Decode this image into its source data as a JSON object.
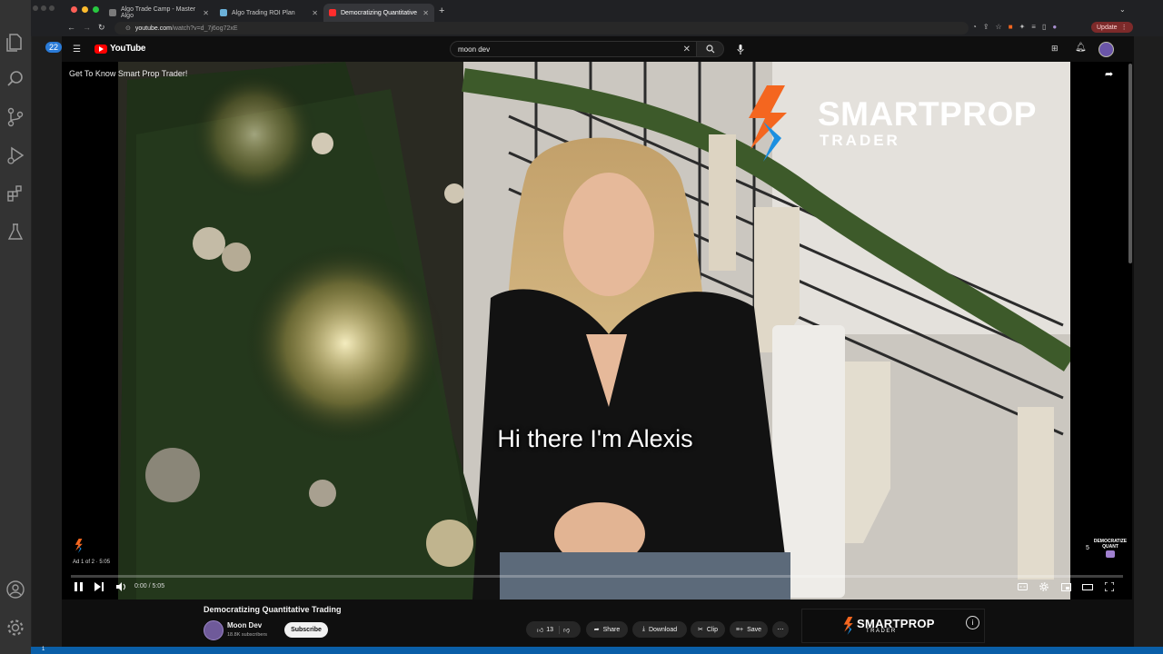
{
  "vscode": {
    "activity_badge": "22",
    "status_left": "1"
  },
  "browser": {
    "tabs": [
      {
        "label": "Algo Trade Camp - Master Algo",
        "color": "#7a7a7a"
      },
      {
        "label": "Algo Trading ROI Plan",
        "color": "#6ab0d8"
      },
      {
        "label": "Democratizing Quantitative",
        "color": "#ff2d2d"
      }
    ],
    "url_host": "youtube.com",
    "url_path": "/watch?v=d_7j6og72xE",
    "update_label": "Update"
  },
  "youtube": {
    "logo": "YouTube",
    "search_value": "moon dev",
    "video_overlay_title": "Get To Know Smart Prop Trader!",
    "subtitle": "Hi there I'm Alexis",
    "brand_main": "SMARTPROP",
    "brand_sub": "TRADER",
    "ad_info": "Ad 1 of 2 · 5:05",
    "time_display": "0:00 / 5:05",
    "skip_count": "5",
    "watermark": "DEMOCRATIZE QUANT",
    "video_title": "Democratizing Quantitative Trading",
    "channel_name": "Moon Dev",
    "subscribers": "18.8K subscribers",
    "subscribe_label": "Subscribe",
    "like_count": "13",
    "share_label": "Share",
    "download_label": "Download",
    "clip_label": "Clip",
    "save_label": "Save",
    "side_ad_brand": "SMARTPROP",
    "side_ad_sub": "TRADER",
    "progress_fraction": 0.0
  },
  "colors": {
    "brand_orange": "#f4661f",
    "brand_blue": "#1c8fe0",
    "youtube_red": "#ff0000"
  }
}
